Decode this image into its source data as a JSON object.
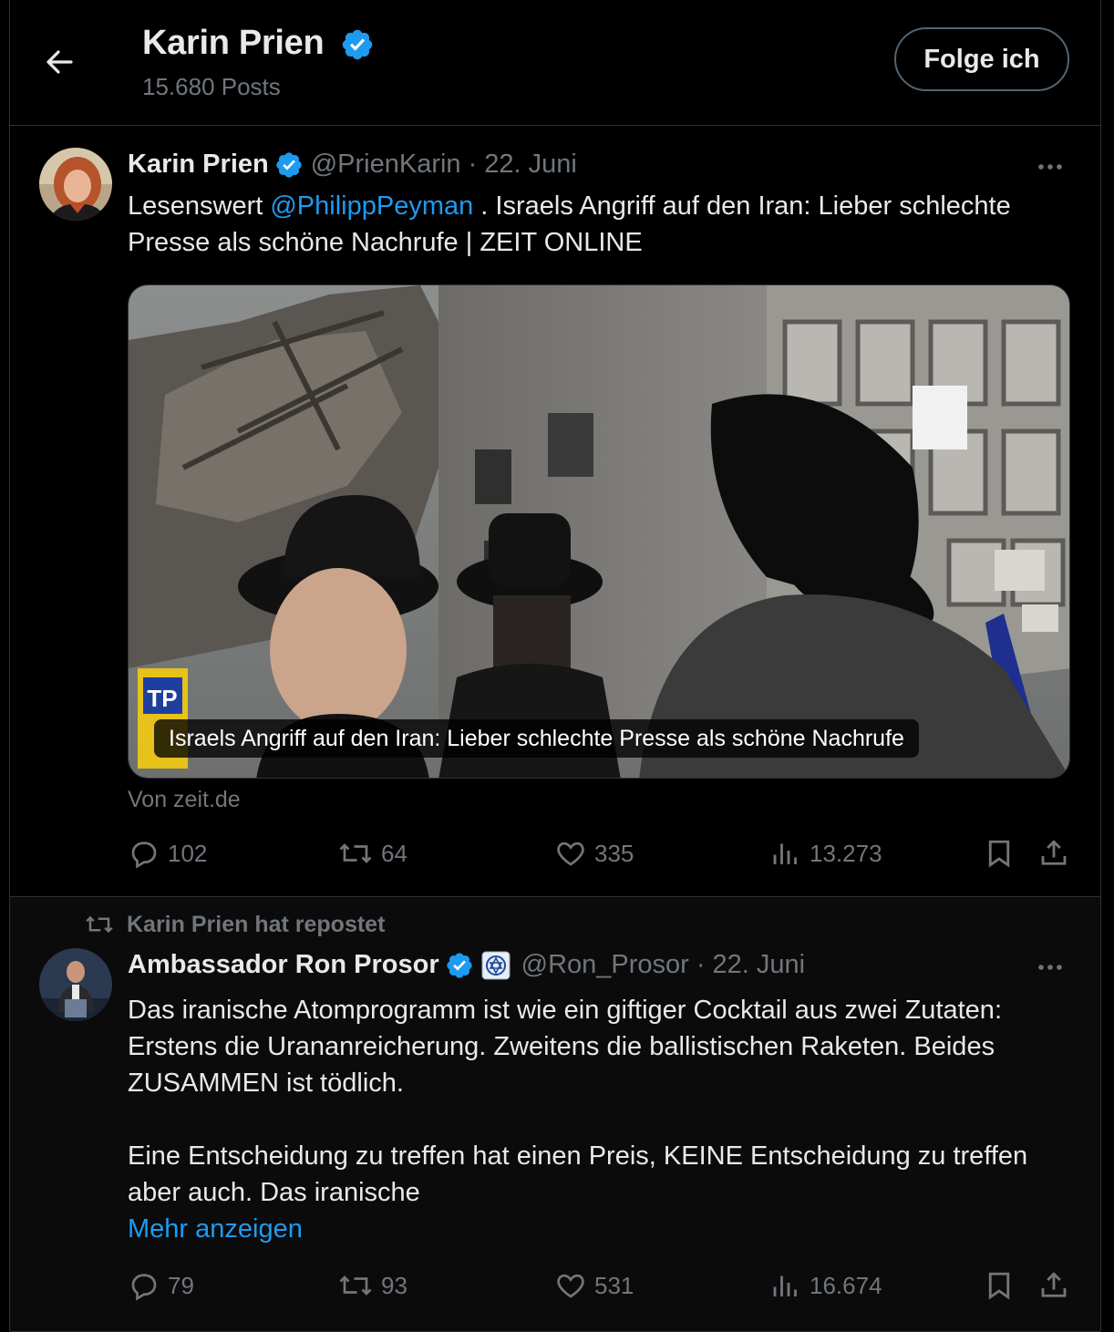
{
  "header": {
    "name": "Karin Prien",
    "posts": "15.680 Posts",
    "follow_label": "Folge ich"
  },
  "tweet1": {
    "name": "Karin Prien",
    "handle": "@PrienKarin",
    "sep": "·",
    "date": "22. Juni",
    "text_pre": "Lesenswert ",
    "mention": "@PhilippPeyman",
    "text_post": " . Israels Angriff auf den Iran: Lieber schlechte Presse als schöne Nachrufe | ZEIT ONLINE",
    "card_caption": "Israels Angriff auf den Iran: Lieber schlechte Presse als schöne Nachrufe",
    "card_source": "Von zeit.de",
    "sign_text": "TP",
    "replies": "102",
    "reposts": "64",
    "likes": "335",
    "views": "13.273"
  },
  "tweet2": {
    "repost_label": "Karin Prien hat repostet",
    "name": "Ambassador Ron Prosor",
    "handle": "@Ron_Prosor",
    "sep": "·",
    "date": "22. Juni",
    "para1": "Das iranische Atomprogramm ist wie ein giftiger Cocktail aus zwei Zutaten: Erstens die Urananreicherung. Zweitens die ballistischen Raketen. Beides ZUSAMMEN ist tödlich.",
    "para2": "Eine Entscheidung zu treffen hat einen Preis, KEINE Entscheidung zu treffen aber auch. Das iranische",
    "show_more": "Mehr anzeigen",
    "replies": "79",
    "reposts": "93",
    "likes": "531",
    "views": "16.674"
  },
  "icons": {
    "back": "arrow-left-icon",
    "verified": "verified-badge-icon",
    "more": "more-horizontal-icon",
    "reply": "reply-icon",
    "repost": "repost-icon",
    "like": "heart-icon",
    "views": "views-icon",
    "bookmark": "bookmark-icon",
    "share": "share-icon",
    "affiliate": "israel-emblem-icon"
  },
  "colors": {
    "background": "#000000",
    "text": "#e7e9ea",
    "muted": "#71767b",
    "accent": "#1d9bf0",
    "verified": "#1d9bf0",
    "border": "#2f3336"
  }
}
